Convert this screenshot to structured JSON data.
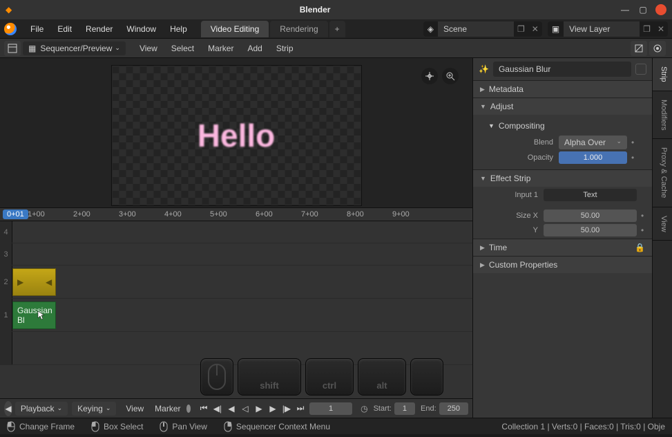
{
  "window": {
    "title": "Blender"
  },
  "topmenu": {
    "file": "File",
    "edit": "Edit",
    "render": "Render",
    "window": "Window",
    "help": "Help"
  },
  "workspace_tabs": {
    "video": "Video Editing",
    "rendering": "Rendering"
  },
  "scene": {
    "label": "Scene"
  },
  "viewlayer": {
    "label": "View Layer"
  },
  "editor": {
    "mode": "Sequencer/Preview",
    "menus": {
      "view": "View",
      "select": "Select",
      "marker": "Marker",
      "add": "Add",
      "strip": "Strip"
    }
  },
  "preview": {
    "text": "Hello"
  },
  "ruler": {
    "playhead": "0+01",
    "ticks": [
      "1+00",
      "2+00",
      "3+00",
      "4+00",
      "5+00",
      "6+00",
      "7+00",
      "8+00",
      "9+00"
    ]
  },
  "tracks": {
    "ch4": "4",
    "ch3": "3",
    "ch2": "2",
    "ch1": "1",
    "gauss_label": "Gaussian Bl"
  },
  "keys": {
    "shift": "shift",
    "ctrl": "ctrl",
    "alt": "alt"
  },
  "props": {
    "name": "Gaussian Blur",
    "metadata": "Metadata",
    "adjust": "Adjust",
    "compositing": "Compositing",
    "blend_label": "Blend",
    "blend_value": "Alpha Over",
    "opacity_label": "Opacity",
    "opacity_value": "1.000",
    "effect_strip": "Effect Strip",
    "input1_label": "Input 1",
    "input1_value": "Text",
    "sizex_label": "Size X",
    "sizex_value": "50.00",
    "sizey_label": "Y",
    "sizey_value": "50.00",
    "time": "Time",
    "custom": "Custom Properties"
  },
  "side_tabs": {
    "strip": "Strip",
    "modifiers": "Modifiers",
    "proxy": "Proxy & Cache",
    "view": "View"
  },
  "playbar": {
    "playback": "Playback",
    "keying": "Keying",
    "view": "View",
    "marker": "Marker",
    "current": "1",
    "start_label": "Start:",
    "start": "1",
    "end_label": "End:",
    "end": "250"
  },
  "status": {
    "change_frame": "Change Frame",
    "box_select": "Box Select",
    "pan_view": "Pan View",
    "ctx_menu": "Sequencer Context Menu",
    "right": "Collection 1 | Verts:0 | Faces:0 | Tris:0 | Obje"
  }
}
